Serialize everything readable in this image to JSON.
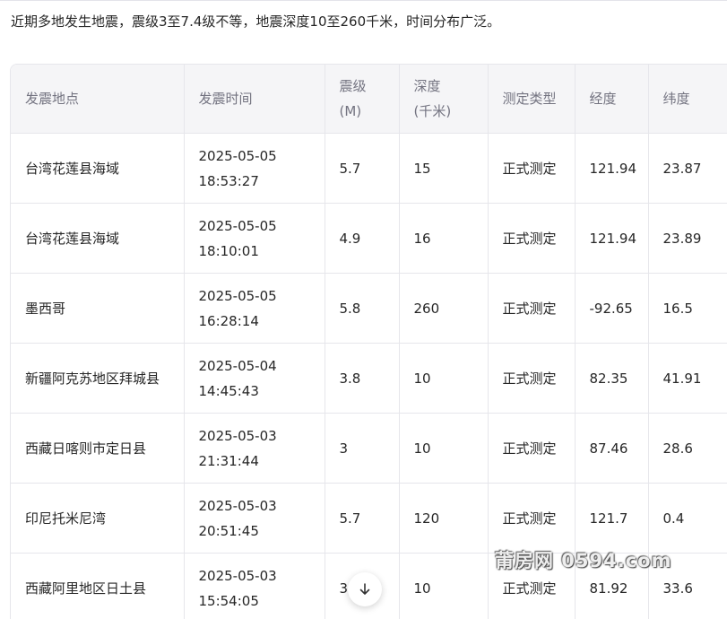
{
  "summary": "近期多地发生地震，震级3至7.4级不等，地震深度10至260千米，时间分布广泛。",
  "table": {
    "headers": [
      {
        "line1": "发震地点",
        "line2": ""
      },
      {
        "line1": "发震时间",
        "line2": ""
      },
      {
        "line1": "震级",
        "line2": "(M)"
      },
      {
        "line1": "深度",
        "line2": "(千米)"
      },
      {
        "line1": "测定类型",
        "line2": ""
      },
      {
        "line1": "经度",
        "line2": ""
      },
      {
        "line1": "纬度",
        "line2": ""
      }
    ],
    "rows": [
      {
        "location": "台湾花莲县海域",
        "date": "2025-05-05",
        "time": "18:53:27",
        "magnitude": "5.7",
        "depth": "15",
        "type": "正式测定",
        "longitude": "121.94",
        "latitude": "23.87"
      },
      {
        "location": "台湾花莲县海域",
        "date": "2025-05-05",
        "time": "18:10:01",
        "magnitude": "4.9",
        "depth": "16",
        "type": "正式测定",
        "longitude": "121.94",
        "latitude": "23.89"
      },
      {
        "location": "墨西哥",
        "date": "2025-05-05",
        "time": "16:28:14",
        "magnitude": "5.8",
        "depth": "260",
        "type": "正式测定",
        "longitude": "-92.65",
        "latitude": "16.5"
      },
      {
        "location": "新疆阿克苏地区拜城县",
        "date": "2025-05-04",
        "time": "14:45:43",
        "magnitude": "3.8",
        "depth": "10",
        "type": "正式测定",
        "longitude": "82.35",
        "latitude": "41.91"
      },
      {
        "location": "西藏日喀则市定日县",
        "date": "2025-05-03",
        "time": "21:31:44",
        "magnitude": "3",
        "depth": "10",
        "type": "正式测定",
        "longitude": "87.46",
        "latitude": "28.6"
      },
      {
        "location": "印尼托米尼湾",
        "date": "2025-05-03",
        "time": "20:51:45",
        "magnitude": "5.7",
        "depth": "120",
        "type": "正式测定",
        "longitude": "121.7",
        "latitude": "0.4"
      },
      {
        "location": "西藏阿里地区日土县",
        "date": "2025-05-03",
        "time": "15:54:05",
        "magnitude": "3",
        "depth": "10",
        "type": "正式测定",
        "longitude": "81.92",
        "latitude": "33.6"
      }
    ]
  },
  "scroll_button": {
    "icon": "arrow-down-icon"
  },
  "watermark": "莆房网 0594.com"
}
